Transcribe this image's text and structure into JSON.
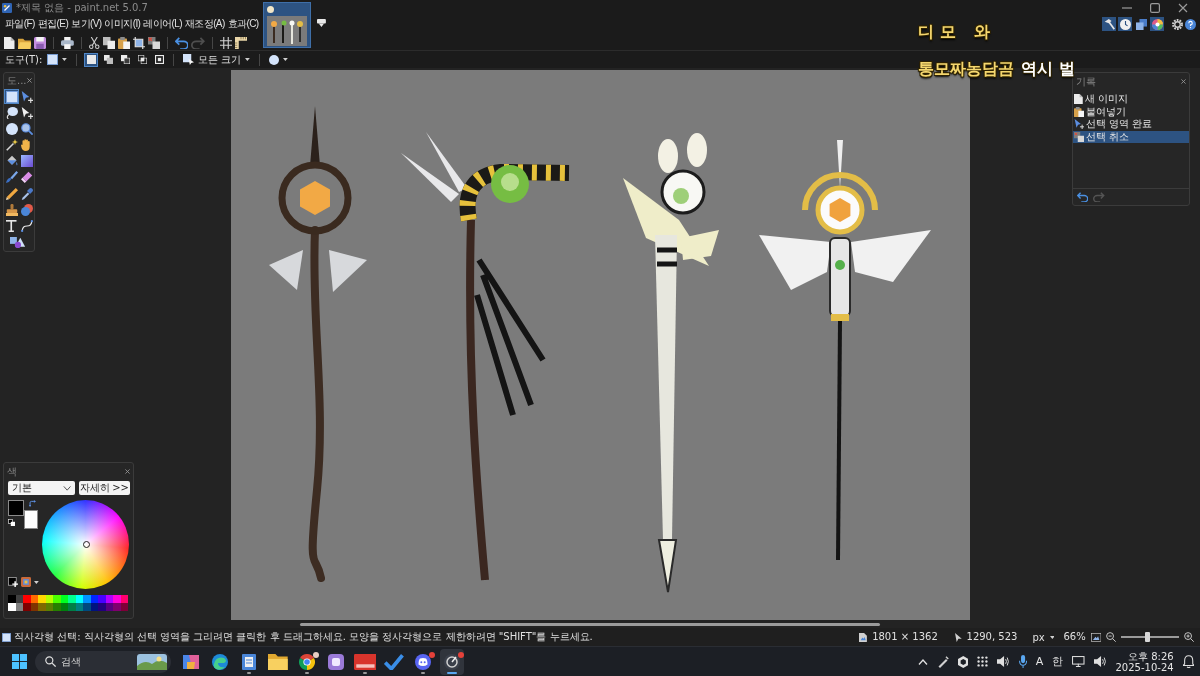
{
  "window": {
    "title": "*제목 없음 - paint.net 5.0.7"
  },
  "menu": [
    {
      "label": "파일(F)"
    },
    {
      "label": "편집(E)"
    },
    {
      "label": "보기(V)"
    },
    {
      "label": "이미지(I)"
    },
    {
      "label": "레이어(L)"
    },
    {
      "label": "재조정(A)"
    },
    {
      "label": "효과(C)"
    }
  ],
  "image_tabs": [
    {
      "selected": true
    }
  ],
  "panel_toggles": [
    {
      "kind": "tools",
      "on": true
    },
    {
      "kind": "history",
      "on": true
    },
    {
      "kind": "layers",
      "on": false
    },
    {
      "kind": "colors",
      "on": true
    }
  ],
  "toolbar_groups": [
    {
      "items": [
        {
          "kind": "new-file",
          "disabled": false
        },
        {
          "kind": "folder",
          "disabled": false
        },
        {
          "kind": "save",
          "disabled": false
        }
      ]
    },
    {
      "items": [
        {
          "kind": "print",
          "disabled": false
        }
      ]
    },
    {
      "items": [
        {
          "kind": "cut",
          "disabled": false
        },
        {
          "kind": "copy",
          "disabled": false
        },
        {
          "kind": "paste",
          "disabled": false
        },
        {
          "kind": "crop",
          "disabled": false
        },
        {
          "kind": "deselect",
          "disabled": false
        }
      ]
    },
    {
      "items": [
        {
          "kind": "undo",
          "disabled": false
        },
        {
          "kind": "redo",
          "disabled": true
        }
      ]
    },
    {
      "items": [
        {
          "kind": "grid",
          "disabled": false
        },
        {
          "kind": "rulers",
          "disabled": false
        }
      ]
    }
  ],
  "tool_options": {
    "label": "도구(T):",
    "selection_modes": [
      {
        "kind": "replace",
        "selected": true
      },
      {
        "kind": "union",
        "selected": false
      },
      {
        "kind": "exclude",
        "selected": false
      },
      {
        "kind": "intersect",
        "selected": false
      },
      {
        "kind": "xor",
        "selected": false
      }
    ],
    "sampling": "모든 크기"
  },
  "overlay_captions": [
    {
      "segments": [
        {
          "text": "디모 와",
          "color": "#f5d76e"
        }
      ]
    },
    {
      "segments": [
        {
          "text": "통모짜농담곰",
          "color": "#f5d76e"
        },
        {
          "text": "역시 벌",
          "color": "#ffffff"
        }
      ]
    }
  ],
  "toolbox": {
    "title": "도...",
    "tools": [
      {
        "kind": "rectangle-select",
        "selected": true
      },
      {
        "kind": "move-selected",
        "selected": false
      },
      {
        "kind": "lasso",
        "selected": false
      },
      {
        "kind": "move-selection",
        "selected": false
      },
      {
        "kind": "ellipse-select",
        "selected": false
      },
      {
        "kind": "zoom",
        "selected": false
      },
      {
        "kind": "magic-wand",
        "selected": false
      },
      {
        "kind": "pan",
        "selected": false
      },
      {
        "kind": "paint-bucket",
        "selected": false
      },
      {
        "kind": "gradient",
        "selected": false
      },
      {
        "kind": "paintbrush",
        "selected": false
      },
      {
        "kind": "eraser",
        "selected": false
      },
      {
        "kind": "pencil",
        "selected": false
      },
      {
        "kind": "color-picker",
        "selected": false
      },
      {
        "kind": "clone-stamp",
        "selected": false
      },
      {
        "kind": "recolor",
        "selected": false
      },
      {
        "kind": "text",
        "selected": false
      },
      {
        "kind": "line-curve",
        "selected": false
      },
      {
        "kind": "shapes",
        "selected": false
      }
    ]
  },
  "history": {
    "title": "기록",
    "items": [
      {
        "kind": "new-image",
        "label": "새 이미지",
        "selected": false
      },
      {
        "kind": "paste",
        "label": "붙여넣기",
        "selected": false
      },
      {
        "kind": "finish-selection",
        "label": "선택 영역 완료",
        "selected": false
      },
      {
        "kind": "deselect",
        "label": "선택 취소",
        "selected": true
      }
    ],
    "undo_disabled": false,
    "redo_disabled": true
  },
  "colors": {
    "title": "색",
    "palette_name": "기본",
    "more_button": "자세히 >>",
    "swatches": [
      {
        "kind": "primary",
        "color": "#000000"
      },
      {
        "kind": "secondary",
        "color": "#ffffff"
      }
    ],
    "palette": [
      {
        "color": "#000000"
      },
      {
        "color": "#404040"
      },
      {
        "color": "#ff0000"
      },
      {
        "color": "#ff6a00"
      },
      {
        "color": "#ffd800"
      },
      {
        "color": "#b6ff00"
      },
      {
        "color": "#4cff00"
      },
      {
        "color": "#00ff21"
      },
      {
        "color": "#00ff90"
      },
      {
        "color": "#00ffff"
      },
      {
        "color": "#0094ff"
      },
      {
        "color": "#0026ff"
      },
      {
        "color": "#4800ff"
      },
      {
        "color": "#b200ff"
      },
      {
        "color": "#ff00dc"
      },
      {
        "color": "#ff006e"
      },
      {
        "color": "#ffffff"
      },
      {
        "color": "#808080"
      },
      {
        "color": "#7f0000"
      },
      {
        "color": "#7f3300"
      },
      {
        "color": "#7f6a00"
      },
      {
        "color": "#5b7f00"
      },
      {
        "color": "#267f00"
      },
      {
        "color": "#007f0e"
      },
      {
        "color": "#007f46"
      },
      {
        "color": "#007f7f"
      },
      {
        "color": "#004a7f"
      },
      {
        "color": "#00137f"
      },
      {
        "color": "#21007f"
      },
      {
        "color": "#57007f"
      },
      {
        "color": "#7f006e"
      },
      {
        "color": "#7f0037"
      }
    ]
  },
  "status_bar": {
    "hint": "직사각형 선택: 직사각형의 선택 영역을 그리려면 클릭한 후 드래그하세요. 모양을 정사각형으로 제한하려면 \"SHIFT\"를 누르세요.",
    "image_size": "1801 × 1362",
    "cursor_position": "1290, 523",
    "units": "px",
    "zoom": "66%",
    "zoom_slider": {
      "level": 0.45
    }
  },
  "taskbar": {
    "search_placeholder": "검색",
    "apps": [
      {
        "kind": "ribbon",
        "running": false,
        "active": false
      },
      {
        "kind": "swirl",
        "running": false,
        "active": false
      },
      {
        "kind": "document",
        "running": true,
        "active": false
      },
      {
        "kind": "folder",
        "running": false,
        "active": false
      },
      {
        "kind": "ball",
        "running": true,
        "active": false,
        "badge": {
          "color": "#e8cfc4"
        }
      },
      {
        "kind": "rounded-square",
        "running": false,
        "active": false
      },
      {
        "kind": "banner",
        "running": true,
        "active": false
      },
      {
        "kind": "checkmark",
        "running": false,
        "active": false
      },
      {
        "kind": "gamepad",
        "running": true,
        "active": false,
        "badge": {
          "color": "#e5413a"
        }
      },
      {
        "kind": "paint",
        "running": true,
        "active": true,
        "badge": {
          "color": "#e5413a"
        }
      }
    ],
    "tray": {
      "input_mode": "A",
      "language": "한",
      "time": "오후 8:26",
      "date": "2025-10-24"
    }
  }
}
